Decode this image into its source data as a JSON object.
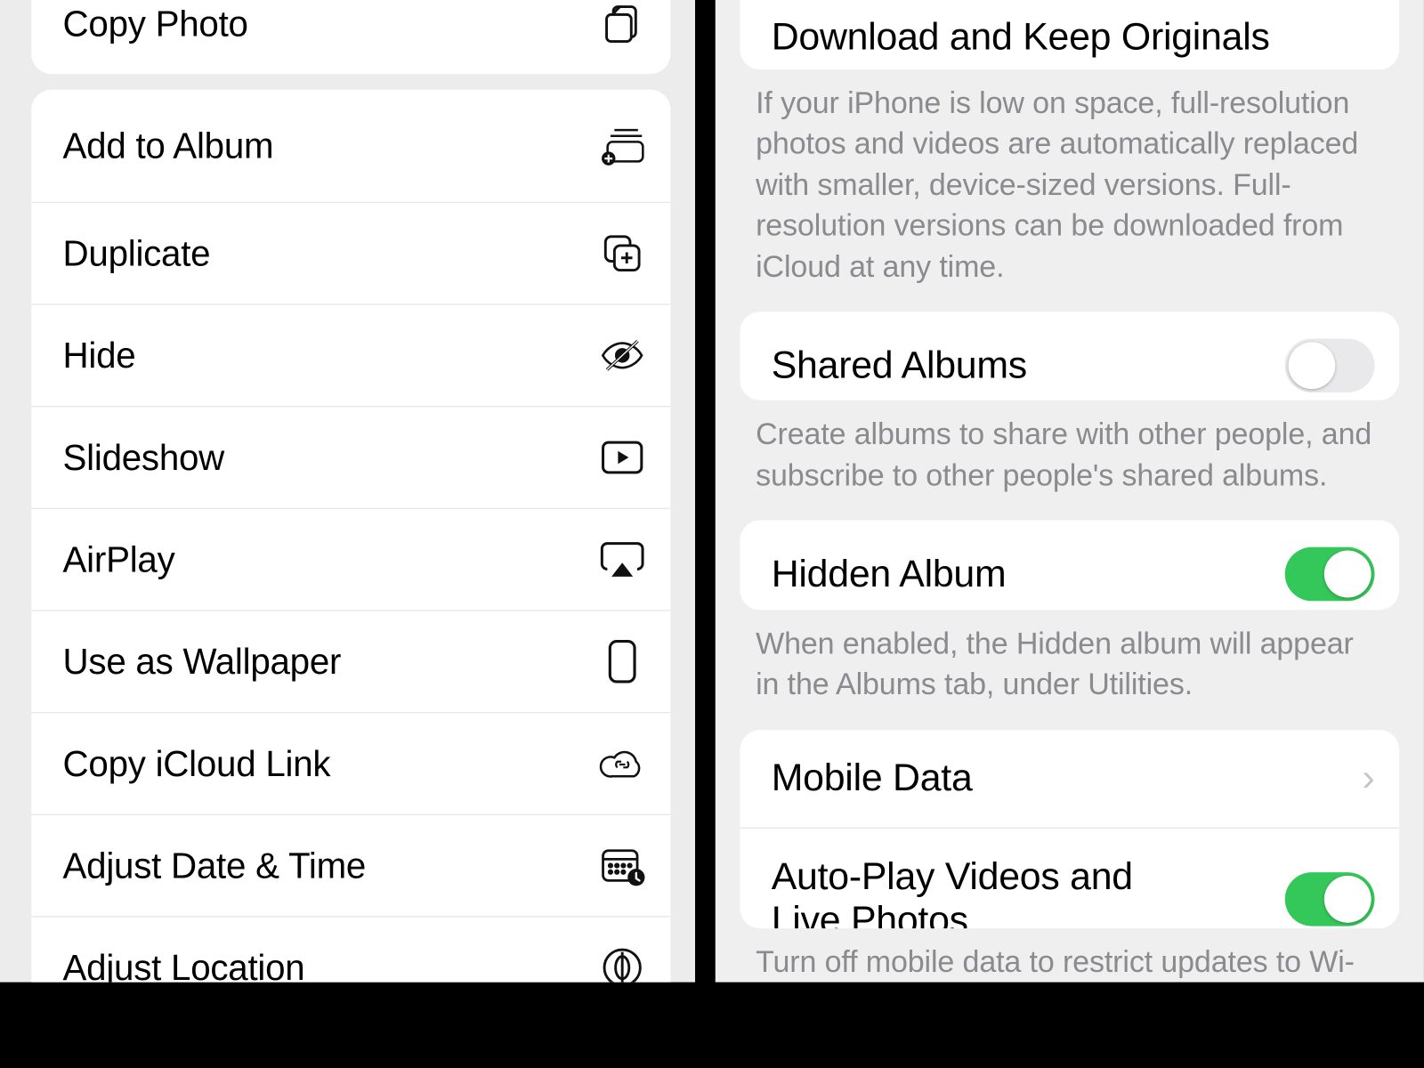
{
  "left_menu": {
    "group1": [
      {
        "label": "Copy Photo",
        "icon": "copy-photo-icon"
      }
    ],
    "group2": [
      {
        "label": "Add to Album",
        "icon": "add-to-album-icon"
      },
      {
        "label": "Duplicate",
        "icon": "duplicate-icon"
      },
      {
        "label": "Hide",
        "icon": "hide-icon"
      },
      {
        "label": "Slideshow",
        "icon": "slideshow-icon"
      },
      {
        "label": "AirPlay",
        "icon": "airplay-icon"
      },
      {
        "label": "Use as Wallpaper",
        "icon": "wallpaper-icon"
      },
      {
        "label": "Copy iCloud Link",
        "icon": "icloud-link-icon"
      },
      {
        "label": "Adjust Date & Time",
        "icon": "adjust-date-icon"
      },
      {
        "label": "Adjust Location",
        "icon": "adjust-location-icon"
      }
    ]
  },
  "right_settings": {
    "download_originals": {
      "label": "Download and Keep Originals"
    },
    "download_footer": "If your iPhone is low on space, full-resolution photos and videos are automatically replaced with smaller, device-sized versions. Full-resolution versions can be downloaded from iCloud at any time.",
    "shared_albums": {
      "label": "Shared Albums",
      "on": false
    },
    "shared_footer": "Create albums to share with other people, and subscribe to other people's shared albums.",
    "hidden_album": {
      "label": "Hidden Album",
      "on": true
    },
    "hidden_footer": "When enabled, the Hidden album will appear in the Albums tab, under Utilities.",
    "mobile_data": {
      "label": "Mobile Data"
    },
    "autoplay": {
      "label": "Auto-Play Videos and Live Photos",
      "on": true
    },
    "mobile_footer": "Turn off mobile data to restrict updates to Wi-"
  }
}
